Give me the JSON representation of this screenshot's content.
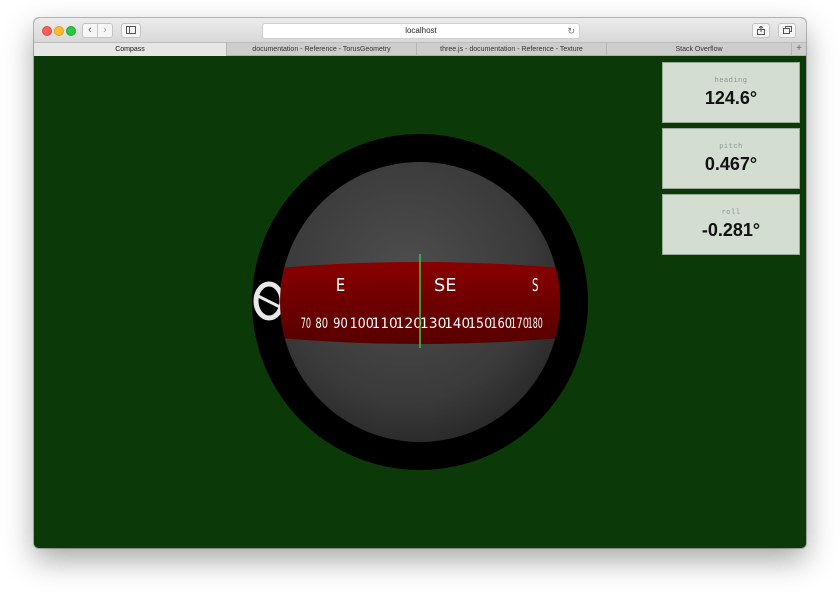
{
  "browser": {
    "address": "localhost",
    "tabs": [
      {
        "label": "Compass",
        "active": true
      },
      {
        "label": "documentation - Reference - TorusGeometry",
        "active": false
      },
      {
        "label": "three.js - documentation - Reference - Texture",
        "active": false
      },
      {
        "label": "Stack Overflow",
        "active": false
      }
    ],
    "icons": {
      "back": "chevron-left-icon",
      "forward": "chevron-right-icon",
      "sidebar": "sidebar-icon",
      "reload": "reload-icon",
      "share": "share-icon",
      "tabs": "tab-overview-icon",
      "new_tab": "plus-icon"
    }
  },
  "readouts": {
    "heading": {
      "label": "heading",
      "value": "124.6°"
    },
    "pitch": {
      "label": "pitch",
      "value": "0.467°"
    },
    "roll": {
      "label": "roll",
      "value": "-0.281°"
    }
  },
  "compass": {
    "cardinals": [
      "E",
      "SE",
      "S"
    ],
    "degree_marks": [
      "70",
      "80",
      "90",
      "100",
      "110",
      "120",
      "130",
      "140",
      "150",
      "160",
      "170",
      "180"
    ],
    "heading_deg": 124.6,
    "colors": {
      "background": "#0b3a08",
      "ring": "#000000",
      "band": "#7a0000",
      "needle": "#3cc83c",
      "text": "#ffffff"
    }
  }
}
